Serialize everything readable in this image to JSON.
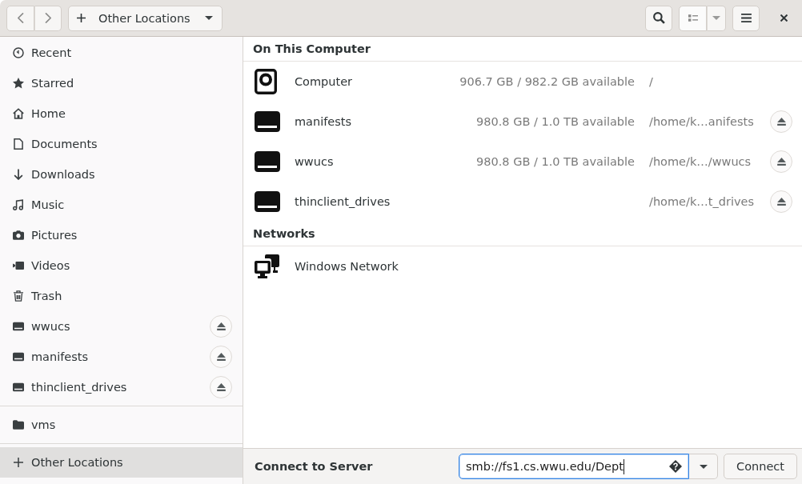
{
  "header_bar": {
    "location_button": {
      "label": "Other Locations"
    }
  },
  "sidebar": {
    "sections": [
      {
        "items": [
          {
            "kind": "recent",
            "label": "Recent",
            "selected": false,
            "ejectable": false
          },
          {
            "kind": "starred",
            "label": "Starred",
            "selected": false,
            "ejectable": false
          },
          {
            "kind": "home",
            "label": "Home",
            "selected": false,
            "ejectable": false
          },
          {
            "kind": "documents",
            "label": "Documents",
            "selected": false,
            "ejectable": false
          },
          {
            "kind": "downloads",
            "label": "Downloads",
            "selected": false,
            "ejectable": false
          },
          {
            "kind": "music",
            "label": "Music",
            "selected": false,
            "ejectable": false
          },
          {
            "kind": "pictures",
            "label": "Pictures",
            "selected": false,
            "ejectable": false
          },
          {
            "kind": "videos",
            "label": "Videos",
            "selected": false,
            "ejectable": false
          },
          {
            "kind": "trash",
            "label": "Trash",
            "selected": false,
            "ejectable": false
          },
          {
            "kind": "drive",
            "label": "wwucs",
            "selected": false,
            "ejectable": true
          },
          {
            "kind": "drive",
            "label": "manifests",
            "selected": false,
            "ejectable": true
          },
          {
            "kind": "drive",
            "label": "thinclient_drives",
            "selected": false,
            "ejectable": true
          }
        ]
      },
      {
        "items": [
          {
            "kind": "folder",
            "label": "vms",
            "selected": false,
            "ejectable": false
          }
        ]
      },
      {
        "items": [
          {
            "kind": "other",
            "label": "Other Locations",
            "selected": true,
            "ejectable": false
          }
        ]
      }
    ]
  },
  "places": {
    "sections": [
      {
        "title": "On This Computer",
        "rows": [
          {
            "kind": "computer",
            "name": "Computer",
            "available": "906.7 GB / 982.2 GB available",
            "path": "/",
            "ejectable": false
          },
          {
            "kind": "drive",
            "name": "manifests",
            "available": "980.8 GB / 1.0 TB available",
            "path": "/home/k…anifests",
            "ejectable": true
          },
          {
            "kind": "drive",
            "name": "wwucs",
            "available": "980.8 GB / 1.0 TB available",
            "path": "/home/k…/wwucs",
            "ejectable": true
          },
          {
            "kind": "drive",
            "name": "thinclient_drives",
            "path": "/home/k…t_drives",
            "ejectable": true
          }
        ]
      },
      {
        "title": "Networks",
        "rows": [
          {
            "kind": "network",
            "name": "Windows Network",
            "ejectable": false
          }
        ]
      }
    ]
  },
  "connect_bar": {
    "label": "Connect to Server",
    "server_field": {
      "value": "smb://fs1.cs.wwu.edu/Dept",
      "focused": true
    },
    "connect_button": "Connect"
  }
}
